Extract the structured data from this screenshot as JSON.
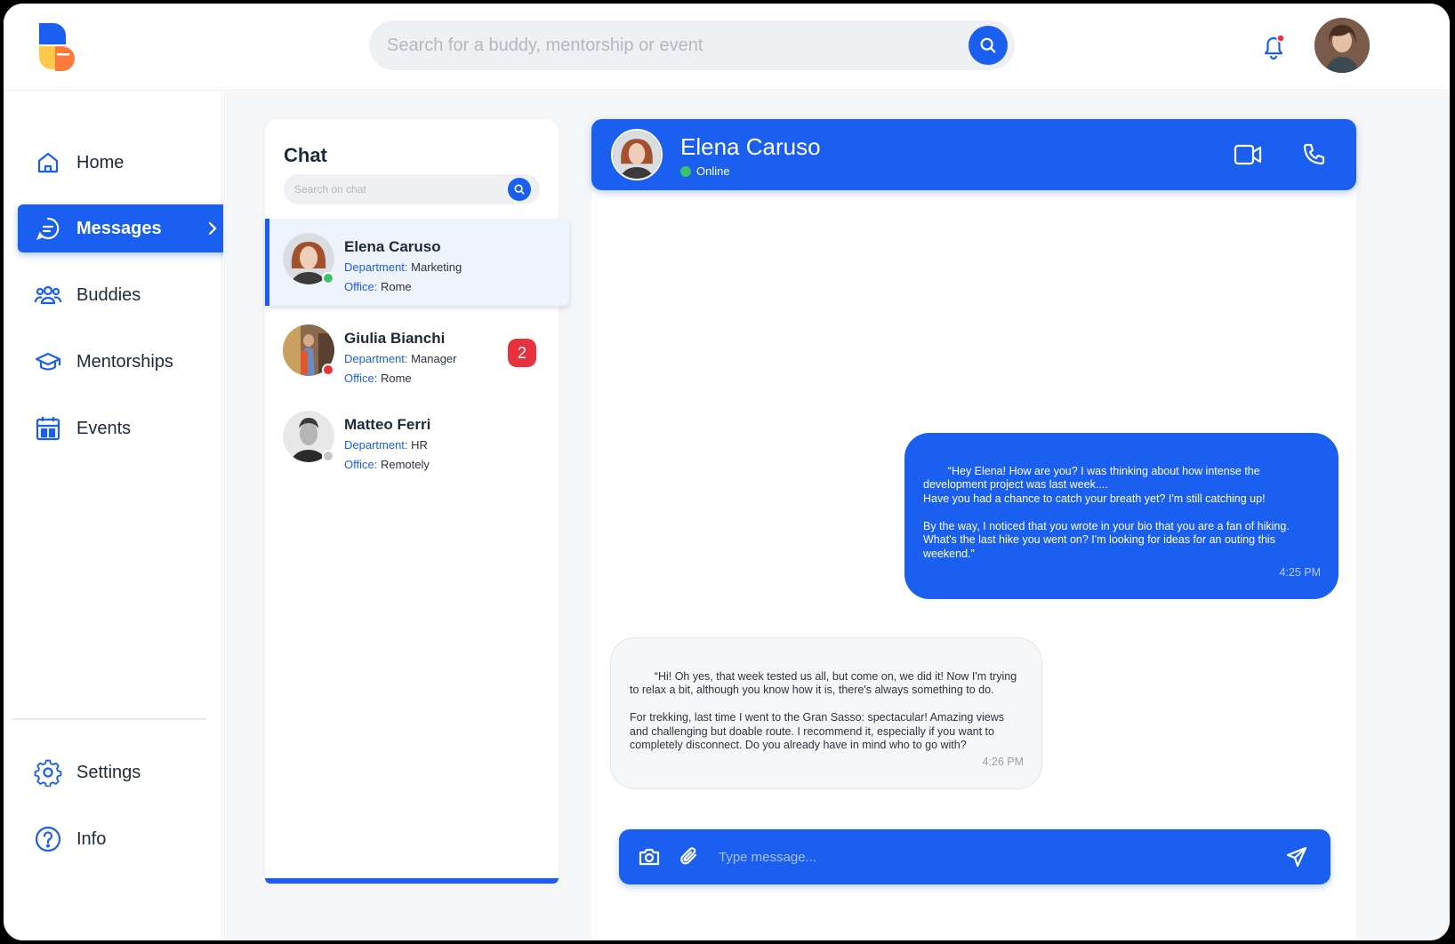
{
  "header": {
    "search_placeholder": "Search for a buddy, mentorship or event",
    "icons": {
      "search": "search-icon",
      "notifications": "bell-icon",
      "profile": "avatar"
    }
  },
  "sidebar": {
    "items": [
      {
        "label": "Home",
        "icon": "home-icon"
      },
      {
        "label": "Messages",
        "icon": "message-icon",
        "active": true
      },
      {
        "label": "Buddies",
        "icon": "people-icon"
      },
      {
        "label": "Mentorships",
        "icon": "graduation-cap-icon"
      },
      {
        "label": "Events",
        "icon": "calendar-icon"
      }
    ],
    "bottom_items": [
      {
        "label": "Settings",
        "icon": "gear-icon"
      },
      {
        "label": "Info",
        "icon": "question-icon"
      }
    ]
  },
  "chat_list": {
    "title": "Chat",
    "search_placeholder": "Search on chat",
    "dept_key": "Department:",
    "office_key": "Office:",
    "contacts": [
      {
        "name": "Elena Caruso",
        "department": "Marketing",
        "office": "Rome",
        "status": "online",
        "unread": ""
      },
      {
        "name": "Giulia Bianchi",
        "department": "Manager",
        "office": "Rome",
        "status": "busy",
        "unread": "2"
      },
      {
        "name": "Matteo Ferri",
        "department": "HR",
        "office": "Remotely",
        "status": "offline",
        "unread": ""
      }
    ]
  },
  "conversation": {
    "contact_name": "Elena Caruso",
    "status": "Online",
    "messages": [
      {
        "direction": "out",
        "text": "“Hey Elena! How are you? I was thinking about how intense the\ndevelopment project was last week....\nHave you had a chance to catch your breath yet? I'm still catching up!\n\nBy the way, I noticed that you wrote in your bio that you are a fan of hiking.\nWhat's the last hike you went on? I'm looking for ideas for an outing this\nweekend.”",
        "time": "4:25 PM"
      },
      {
        "direction": "in",
        "text": "“Hi! Oh yes, that week tested us all, but come on, we did it! Now I'm trying\nto relax a bit, although you know how it is, there's always something to do.\n\nFor trekking, last time I went to the Gran Sasso: spectacular! Amazing views\nand challenging but doable route. I recommend it, especially if you want to\ncompletely disconnect. Do you already have in mind who to go with?",
        "time": "4:26 PM"
      }
    ],
    "composer_placeholder": "Type message..."
  },
  "colors": {
    "accent": "#1a5ff0",
    "online": "#3ac46a",
    "busy": "#e8313f",
    "offline": "#c4c7cc",
    "badge": "#e8313f"
  }
}
